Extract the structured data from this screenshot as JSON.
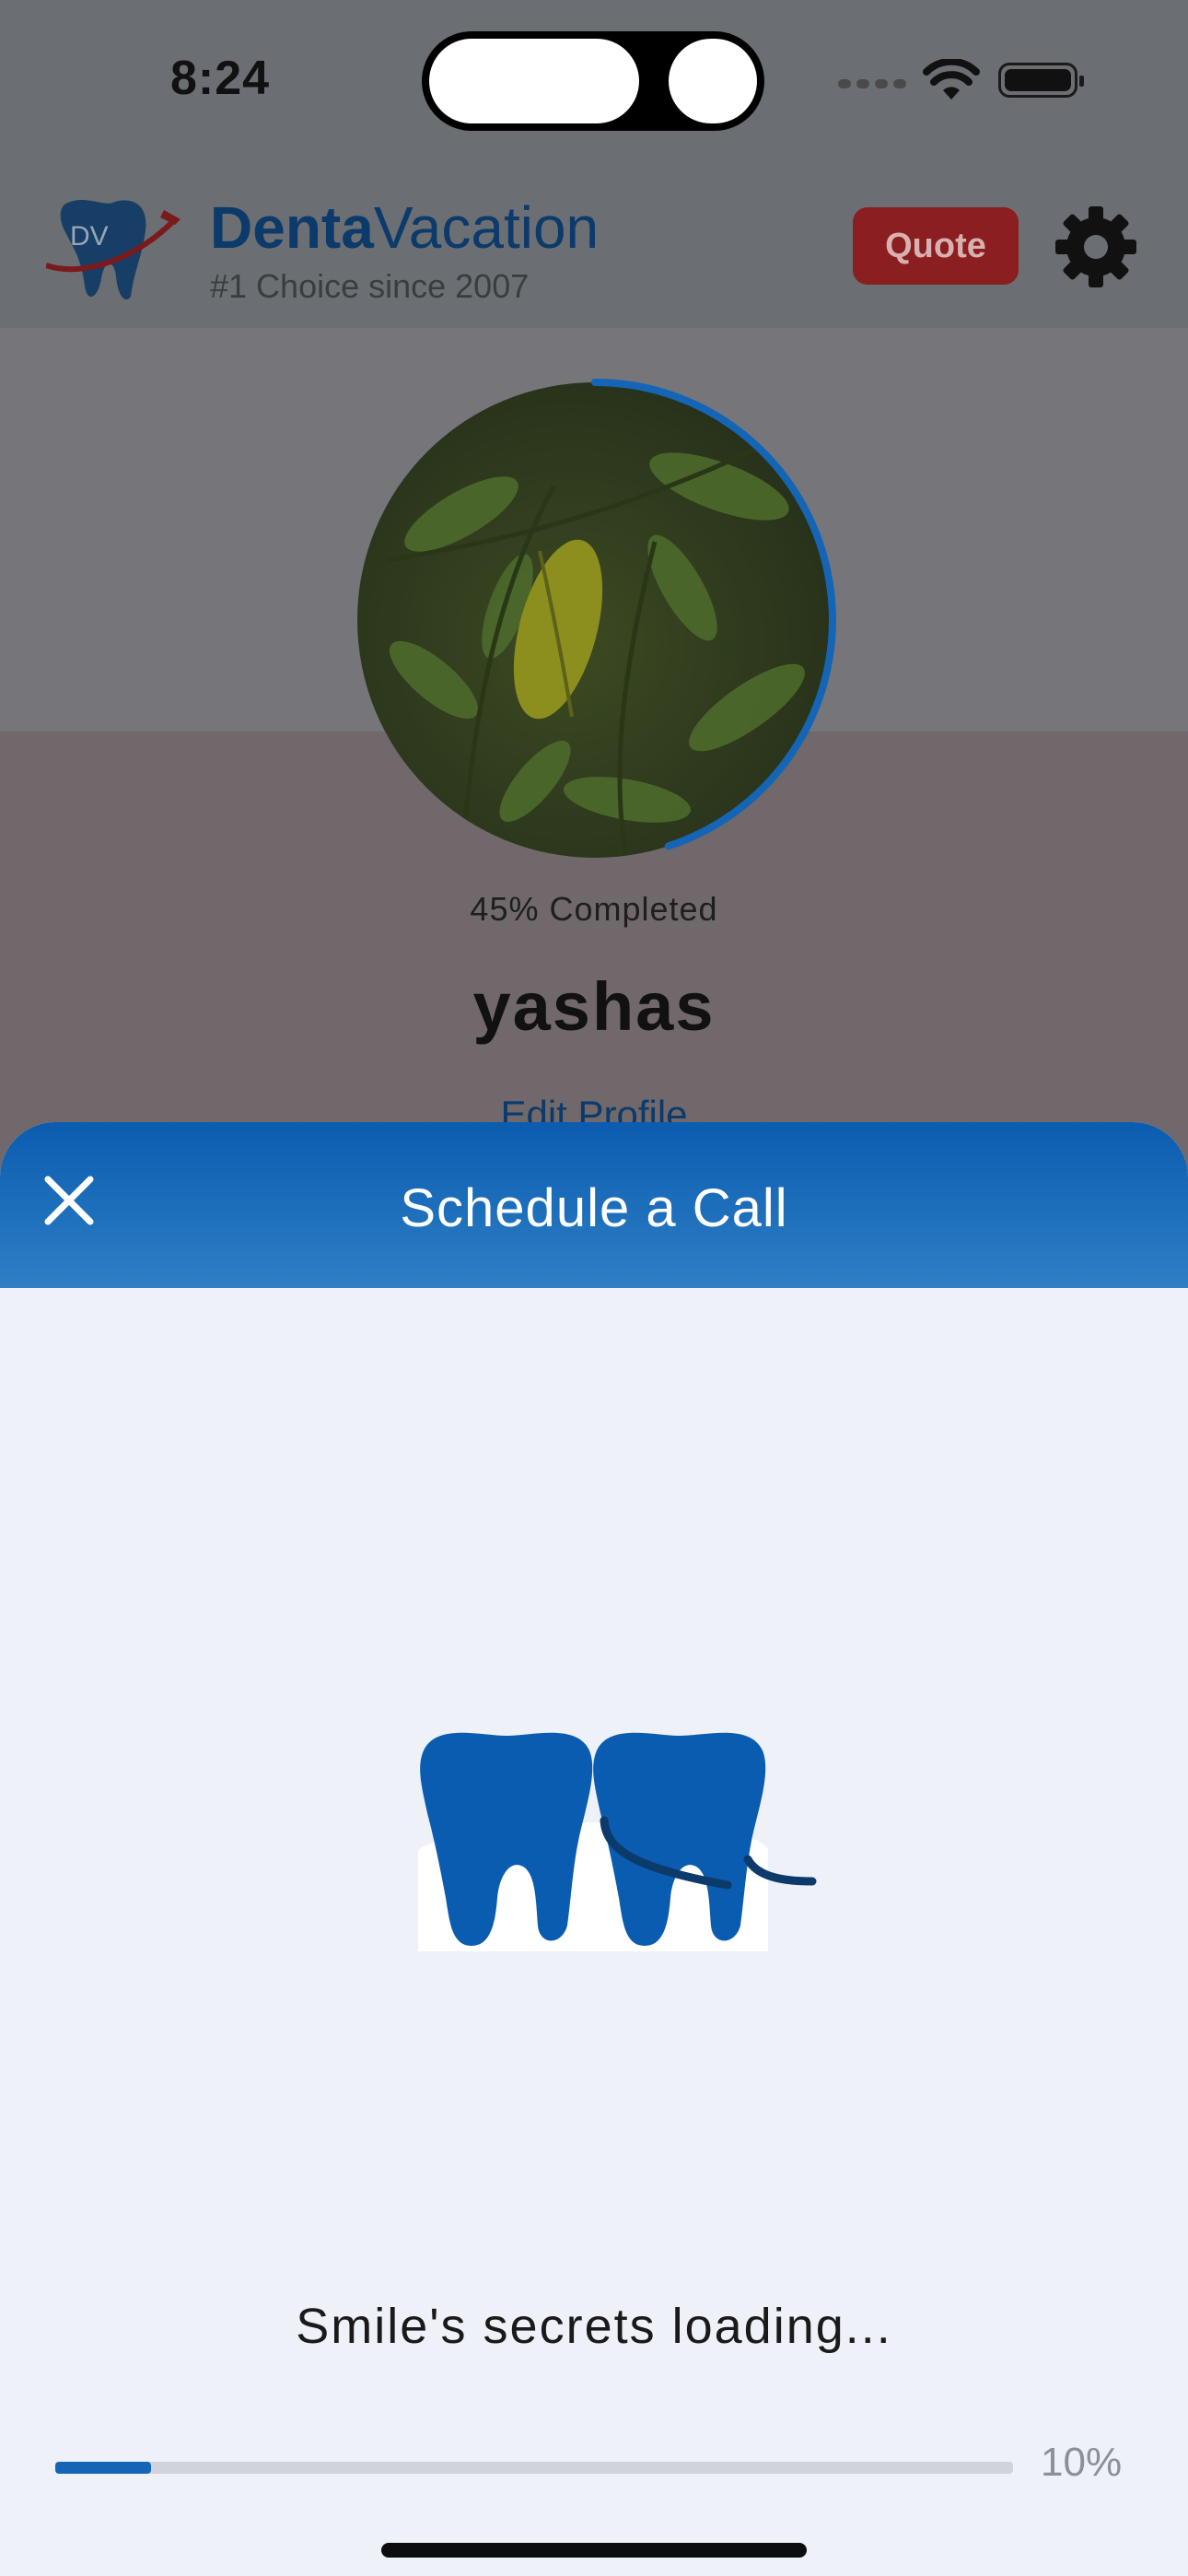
{
  "status_bar": {
    "time": "8:24"
  },
  "app": {
    "brand_bold": "Denta",
    "brand_rest": "Vacation",
    "logo_initials": "DV",
    "tagline": "#1 Choice since 2007",
    "quote_label": "Quote"
  },
  "profile": {
    "completion_fraction": 0.45,
    "progress_label": "45% Completed",
    "username": "yashas",
    "edit_label": "Edit Profile"
  },
  "sheet": {
    "title": "Schedule a Call",
    "loading_text": "Smile's secrets loading...",
    "progress_fraction": 0.1,
    "progress_label": "10%"
  },
  "colors": {
    "brand_blue": "#0b5cb0",
    "quote_red": "#b52a2c",
    "sheet_background": "#eef1f8"
  },
  "icons": [
    "wifi-icon",
    "battery-icon",
    "gear-icon",
    "close-icon",
    "teeth-floss-icon"
  ]
}
